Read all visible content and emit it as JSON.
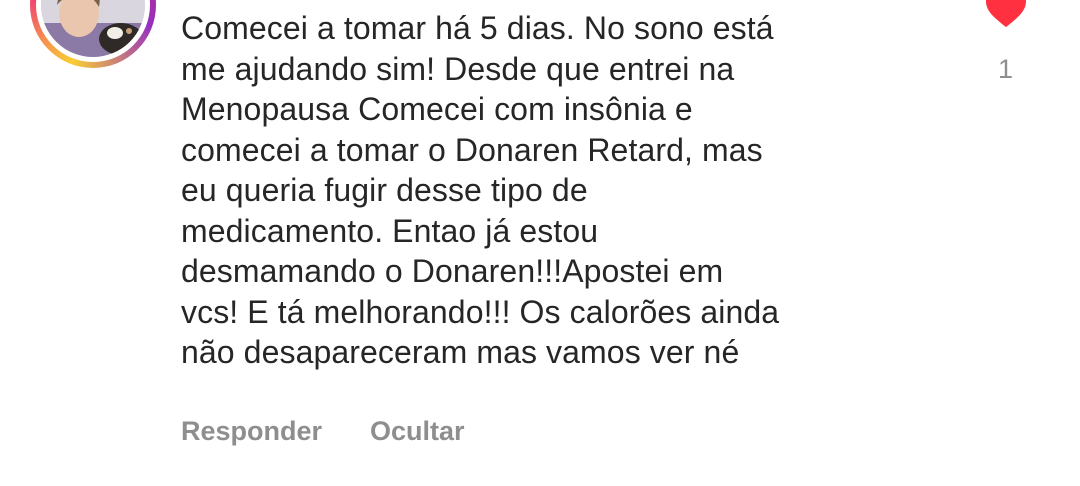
{
  "comment": {
    "lines": [
      "Comecei a tomar há 5 dias. No sono está",
      "me ajudando sim! Desde que entrei na",
      "Menopausa Comecei com insônia e",
      "comecei a tomar o Donaren Retard, mas",
      "eu queria fugir desse tipo de",
      "medicamento. Entao já estou",
      "desmamando o Donaren!!!Apostei em",
      "vcs! E tá melhorando!!! Os calorões ainda",
      "não desapareceram mas vamos ver né"
    ]
  },
  "actions": {
    "reply_label": "Responder",
    "hide_label": "Ocultar"
  },
  "like": {
    "icon": "heart-icon",
    "liked": true,
    "count": "1",
    "color": "#ff3040"
  },
  "colors": {
    "text": "#262626",
    "secondary": "#8e8e8e"
  }
}
